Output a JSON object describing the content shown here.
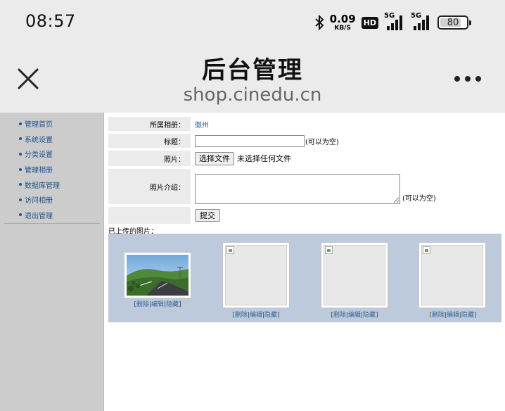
{
  "status": {
    "time": "08:57",
    "net_speed_value": "0.09",
    "net_speed_unit": "KB/S",
    "hd_badge": "HD",
    "signal1_label": "5G",
    "signal2_label": "5G",
    "battery": "80",
    "icons": [
      "bluetooth-icon",
      "hd-icon",
      "signal-icon",
      "battery-icon"
    ]
  },
  "titlebar": {
    "title": "后台管理",
    "subtitle": "shop.cinedu.cn",
    "close_icon": "close-icon",
    "more_icon": "more-dots-icon"
  },
  "sidebar": {
    "items": [
      {
        "label": "管理首页"
      },
      {
        "label": "系统设置"
      },
      {
        "label": "分类设置"
      },
      {
        "label": "管理相册"
      },
      {
        "label": "数据库管理"
      },
      {
        "label": "访问相册"
      },
      {
        "label": "退出管理"
      }
    ]
  },
  "form": {
    "album_label": "所属相册：",
    "album_value": "徽州",
    "title_label": "标题：",
    "title_value": "",
    "title_hint": "(可以为空)",
    "photo_label": "照片：",
    "file_button": "选择文件",
    "file_status": "未选择任何文件",
    "intro_label": "照片介绍：",
    "intro_value": "",
    "intro_hint": "(可以为空)",
    "submit_label": "提交"
  },
  "gallery": {
    "label": "已上传的图片：",
    "items": [
      {
        "delete": "删除",
        "edit": "编辑",
        "hide": "隐藏",
        "sep": "|",
        "open": "[",
        "close": "]"
      },
      {
        "delete": "删除",
        "edit": "编辑",
        "hide": "隐藏",
        "sep": "|",
        "open": "[",
        "close": "]"
      },
      {
        "delete": "删除",
        "edit": "编辑",
        "hide": "隐藏",
        "sep": "|",
        "open": "[",
        "close": "]"
      },
      {
        "delete": "删除",
        "edit": "编辑",
        "hide": "隐藏",
        "sep": "|",
        "open": "[",
        "close": "]"
      }
    ]
  },
  "colors": {
    "bar_bg": "#ebebeb",
    "sidebar_bg": "#cccccc",
    "link": "#336699",
    "gallery_bg": "#bccadb"
  }
}
